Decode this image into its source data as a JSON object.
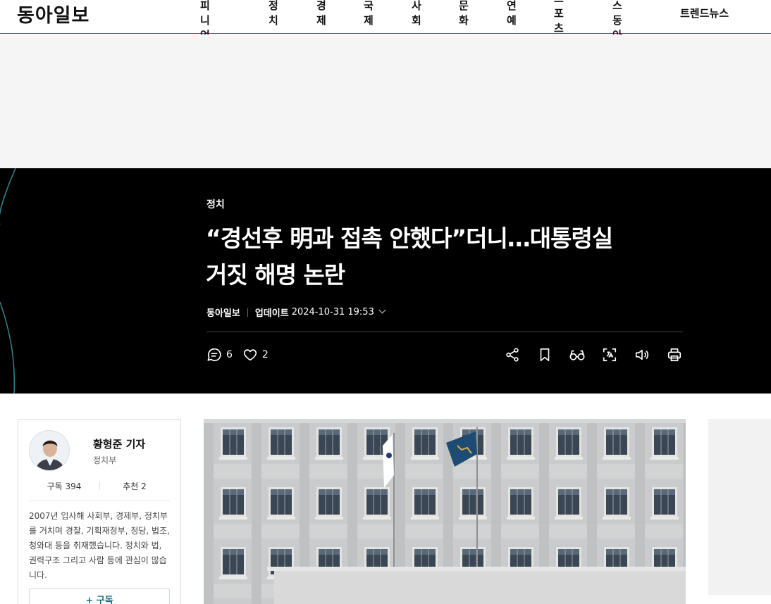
{
  "header": {
    "logo": "동아일보",
    "nav": [
      "오피니언",
      "정치",
      "경제",
      "국제",
      "사회",
      "문화",
      "연예",
      "스포츠",
      "헬스동아",
      "트렌드뉴스"
    ]
  },
  "article": {
    "category": "정치",
    "title_line1": "“경선후 明과 접촉 안했다”더니…대통령실",
    "title_line2": "거짓 해명 논란",
    "source": "동아일보",
    "updated_label": "업데이트",
    "updated_time": "2024-10-31 19:53",
    "comment_count": "6",
    "like_count": "2",
    "tools": [
      "share-icon",
      "bookmark-icon",
      "reading-mode-icon",
      "translate-icon",
      "speaker-icon",
      "print-icon"
    ]
  },
  "reporter": {
    "name": "황형준 기자",
    "dept": "정치부",
    "subscribers": "구독 394",
    "recommends": "추천 2",
    "bio": "2007년 입사해 사회부, 경제부, 정치부를 거치며 경찰, 기획재정부, 정당, 법조, 청와대 등을 취재했습니다. 정치와 법, 권력구조 그리고 사람 등에 관심이 많습니다.",
    "subscribe_button": "+ 구독"
  },
  "colors": {
    "accent": "#1a6f7a",
    "hero_bg": "#000000"
  }
}
